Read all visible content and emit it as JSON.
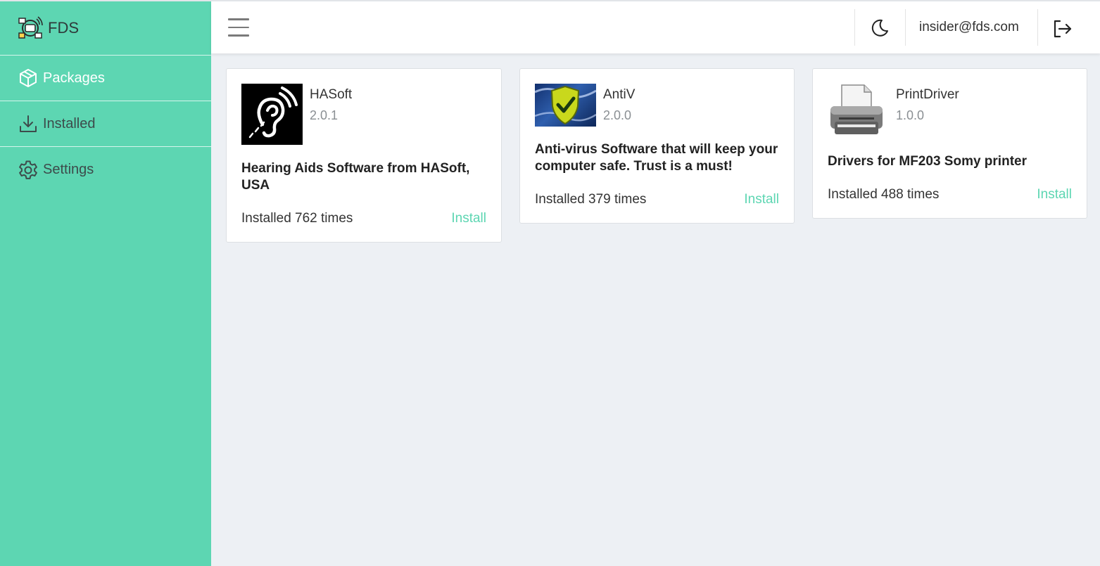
{
  "brand": {
    "name": "FDS"
  },
  "sidebar": {
    "items": [
      {
        "label": "Packages",
        "icon": "package-icon",
        "active": true
      },
      {
        "label": "Installed",
        "icon": "download-icon",
        "active": false
      },
      {
        "label": "Settings",
        "icon": "gear-icon",
        "active": false
      }
    ]
  },
  "header": {
    "user_email": "insider@fds.com",
    "theme_icon": "moon-icon",
    "logout_icon": "logout-icon"
  },
  "packages": [
    {
      "name": "HASoft",
      "version": "2.0.1",
      "description": "Hearing Aids Software from HASoft, USA",
      "installs": "Installed 762 times",
      "action": "Install",
      "icon": "hearing-icon"
    },
    {
      "name": "AntiV",
      "version": "2.0.0",
      "description": "Anti-virus Software that will keep your computer safe. Trust is a must!",
      "installs": "Installed 379 times",
      "action": "Install",
      "icon": "shield-check-icon"
    },
    {
      "name": "PrintDriver",
      "version": "1.0.0",
      "description": "Drivers for MF203 Somy printer",
      "installs": "Installed 488 times",
      "action": "Install",
      "icon": "printer-icon"
    }
  ],
  "colors": {
    "accent": "#5dd6b2",
    "background": "#edf0f4"
  }
}
